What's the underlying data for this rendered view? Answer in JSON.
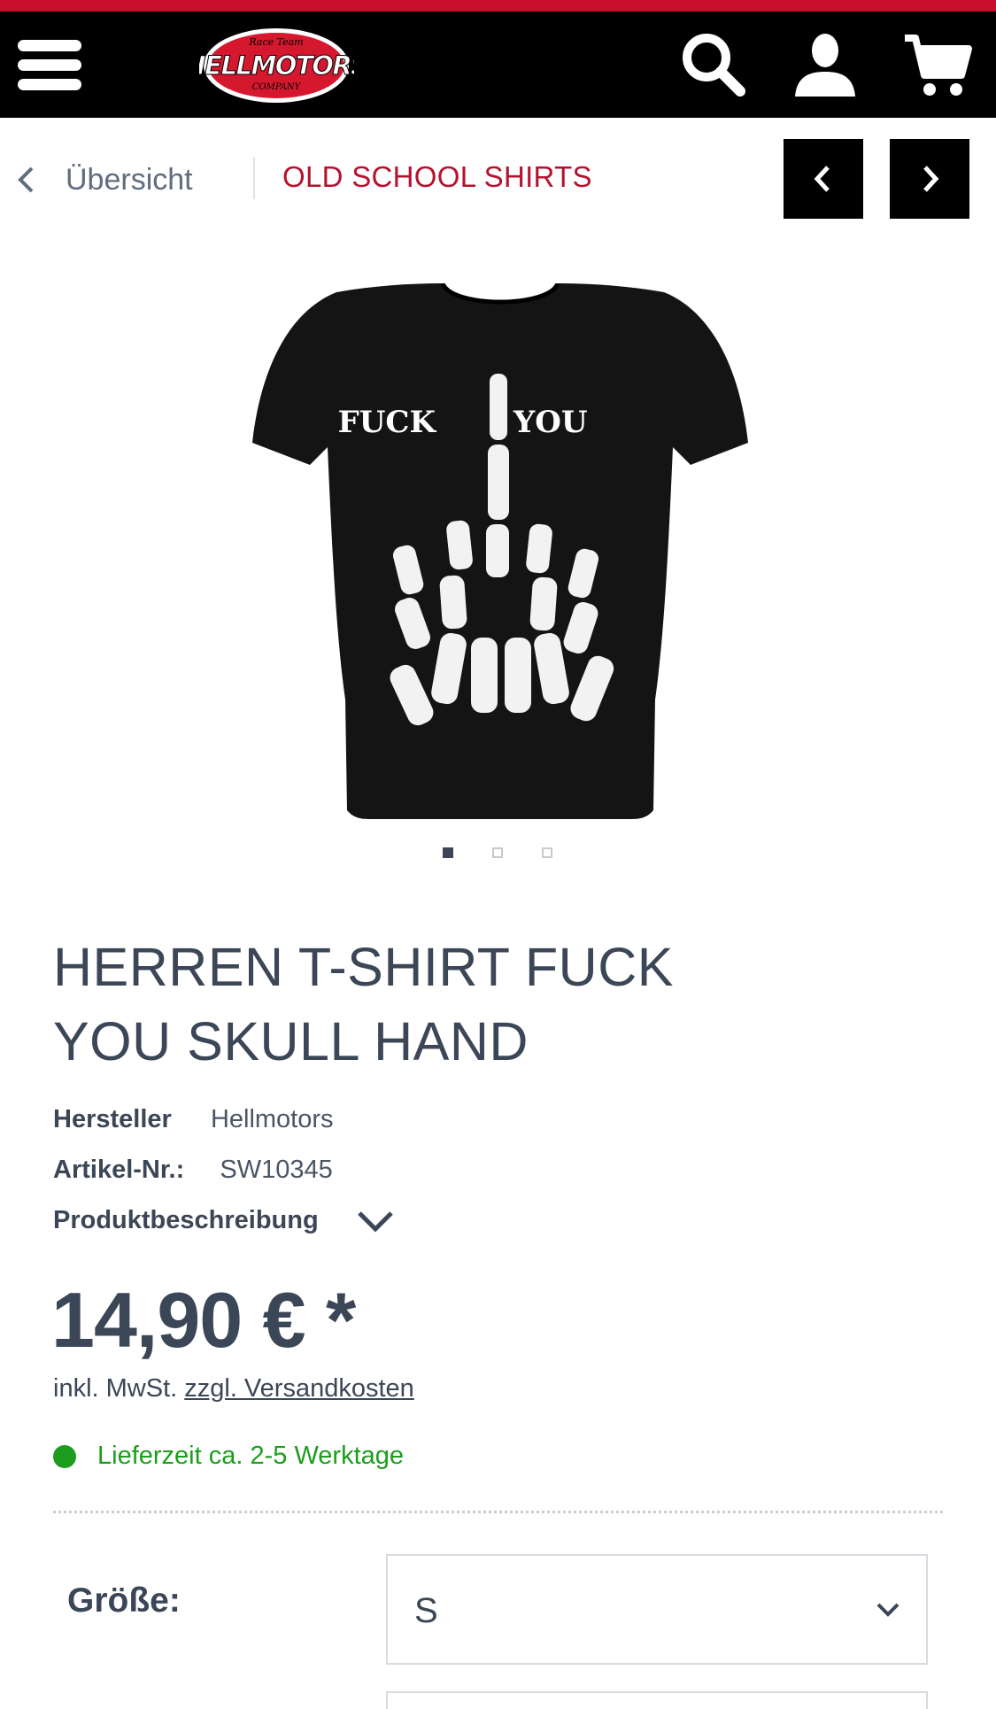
{
  "header": {
    "brand_logo_text": "HELLMOTORS",
    "brand_logo_small_top": "Race Team",
    "brand_logo_small_bottom": "COMPANY",
    "icons": [
      "menu-icon",
      "search-icon",
      "account-icon",
      "cart-icon"
    ],
    "accent_color": "#c8102e"
  },
  "breadcrumb": {
    "back_label": "Übersicht",
    "category_label": "OLD SCHOOL SHIRTS",
    "category_color": "#b5122f"
  },
  "product": {
    "image_text_left": "FUCK",
    "image_text_right": "YOU",
    "image_count": 3,
    "active_image": 1,
    "title": "HERREN T-SHIRT FUCK YOU SKULL HAND",
    "manufacturer_label": "Hersteller",
    "manufacturer_value": "Hellmotors",
    "article_no_label": "Artikel-Nr.:",
    "article_no_value": "SW10345",
    "description_toggle": "Produktbeschreibung",
    "price": "14,90 € *",
    "tax_text": "inkl. MwSt.",
    "shipping_link": "zzgl. Versandkosten",
    "delivery_text": "Lieferzeit ca. 2-5 Werktage",
    "delivery_color": "#1d9d1d",
    "size_label": "Größe:",
    "size_value": "S"
  }
}
